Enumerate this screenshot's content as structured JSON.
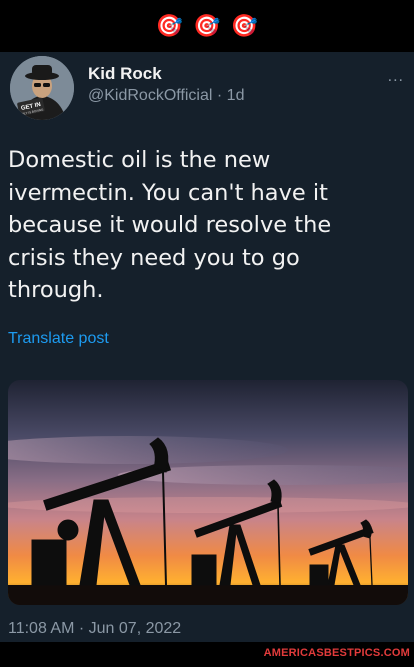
{
  "header": {
    "emojis": [
      "🎯",
      "🎯",
      "🎯"
    ]
  },
  "post": {
    "author_name": "Kid Rock",
    "handle": "@KidRockOfficial",
    "time_ago": "1d",
    "more_label": "...",
    "text": "Domestic oil is the new\nivermectin. You can't have it\nbecause it would resolve the\ncrisis they need you to go\nthrough.",
    "translate_label": "Translate post",
    "timestamp_time": "11:08 AM",
    "timestamp_date": "Jun 07, 2022",
    "avatar_cap_text": "GET IN",
    "avatar_cap_subtext": "BLY IS BOXING"
  },
  "watermark": "AMERICASBESTPICS.COM",
  "colors": {
    "background": "#15202b",
    "link": "#1d9bf0",
    "secondary_text": "#8b98a5"
  }
}
